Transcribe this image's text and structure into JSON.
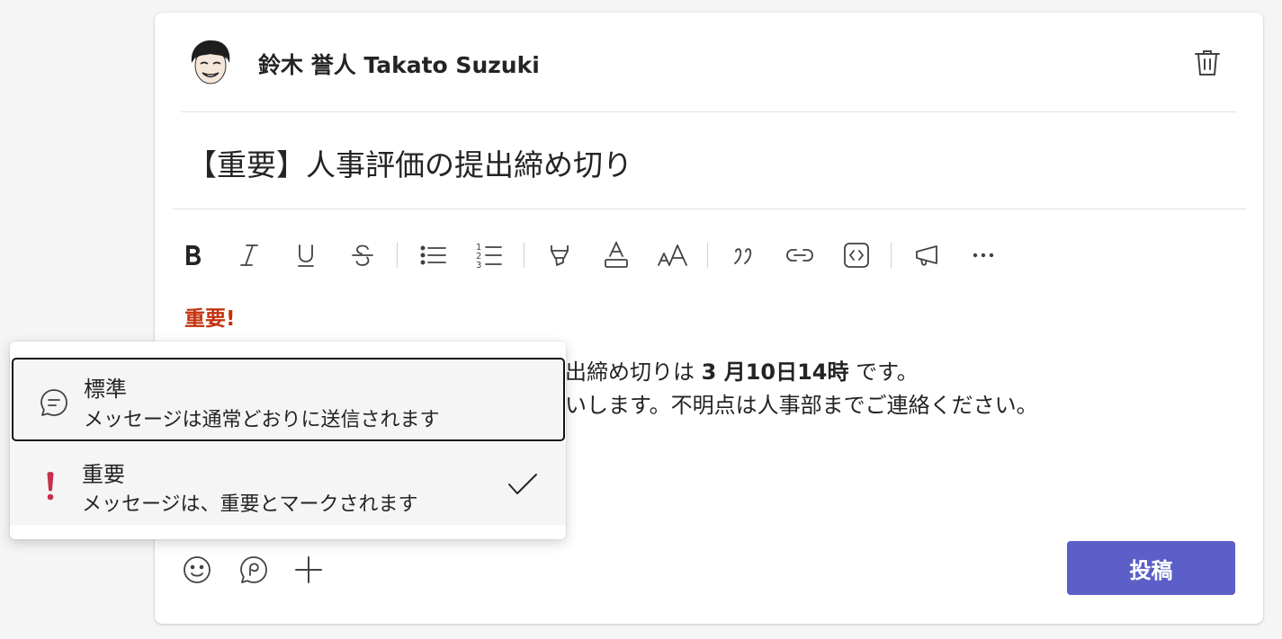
{
  "post": {
    "author": "鈴木 誉人 Takato Suzuki",
    "subject": "【重要】人事評価の提出締め切り",
    "importance_label": "重要!",
    "body_line1_prefix": "出締め切りは",
    "body_line1_bold": "3 月10日14時",
    "body_line1_suffix": "です。",
    "body_line2": "いします。不明点は人事部までご連絡ください。"
  },
  "toolbar": {
    "buttons": [
      "bold-icon",
      "italic-icon",
      "underline-icon",
      "strikethrough-icon",
      "bullet-list-icon",
      "numbered-list-icon",
      "highlight-icon",
      "font-color-icon",
      "font-size-icon",
      "quote-icon",
      "link-icon",
      "code-snippet-icon",
      "announcement-icon",
      "more-icon"
    ]
  },
  "importance_menu": {
    "options": [
      {
        "title": "標準",
        "description": "メッセージは通常どおりに送信されます",
        "icon": "chat-icon"
      },
      {
        "title": "重要",
        "description": "メッセージは、重要とマークされます",
        "icon": "exclamation-icon",
        "selected": true
      }
    ]
  },
  "actions": {
    "post_label": "投稿"
  },
  "colors": {
    "accent": "#5b5fc7",
    "importance_text": "#c4310e",
    "importance_icon": "#c4314b"
  }
}
